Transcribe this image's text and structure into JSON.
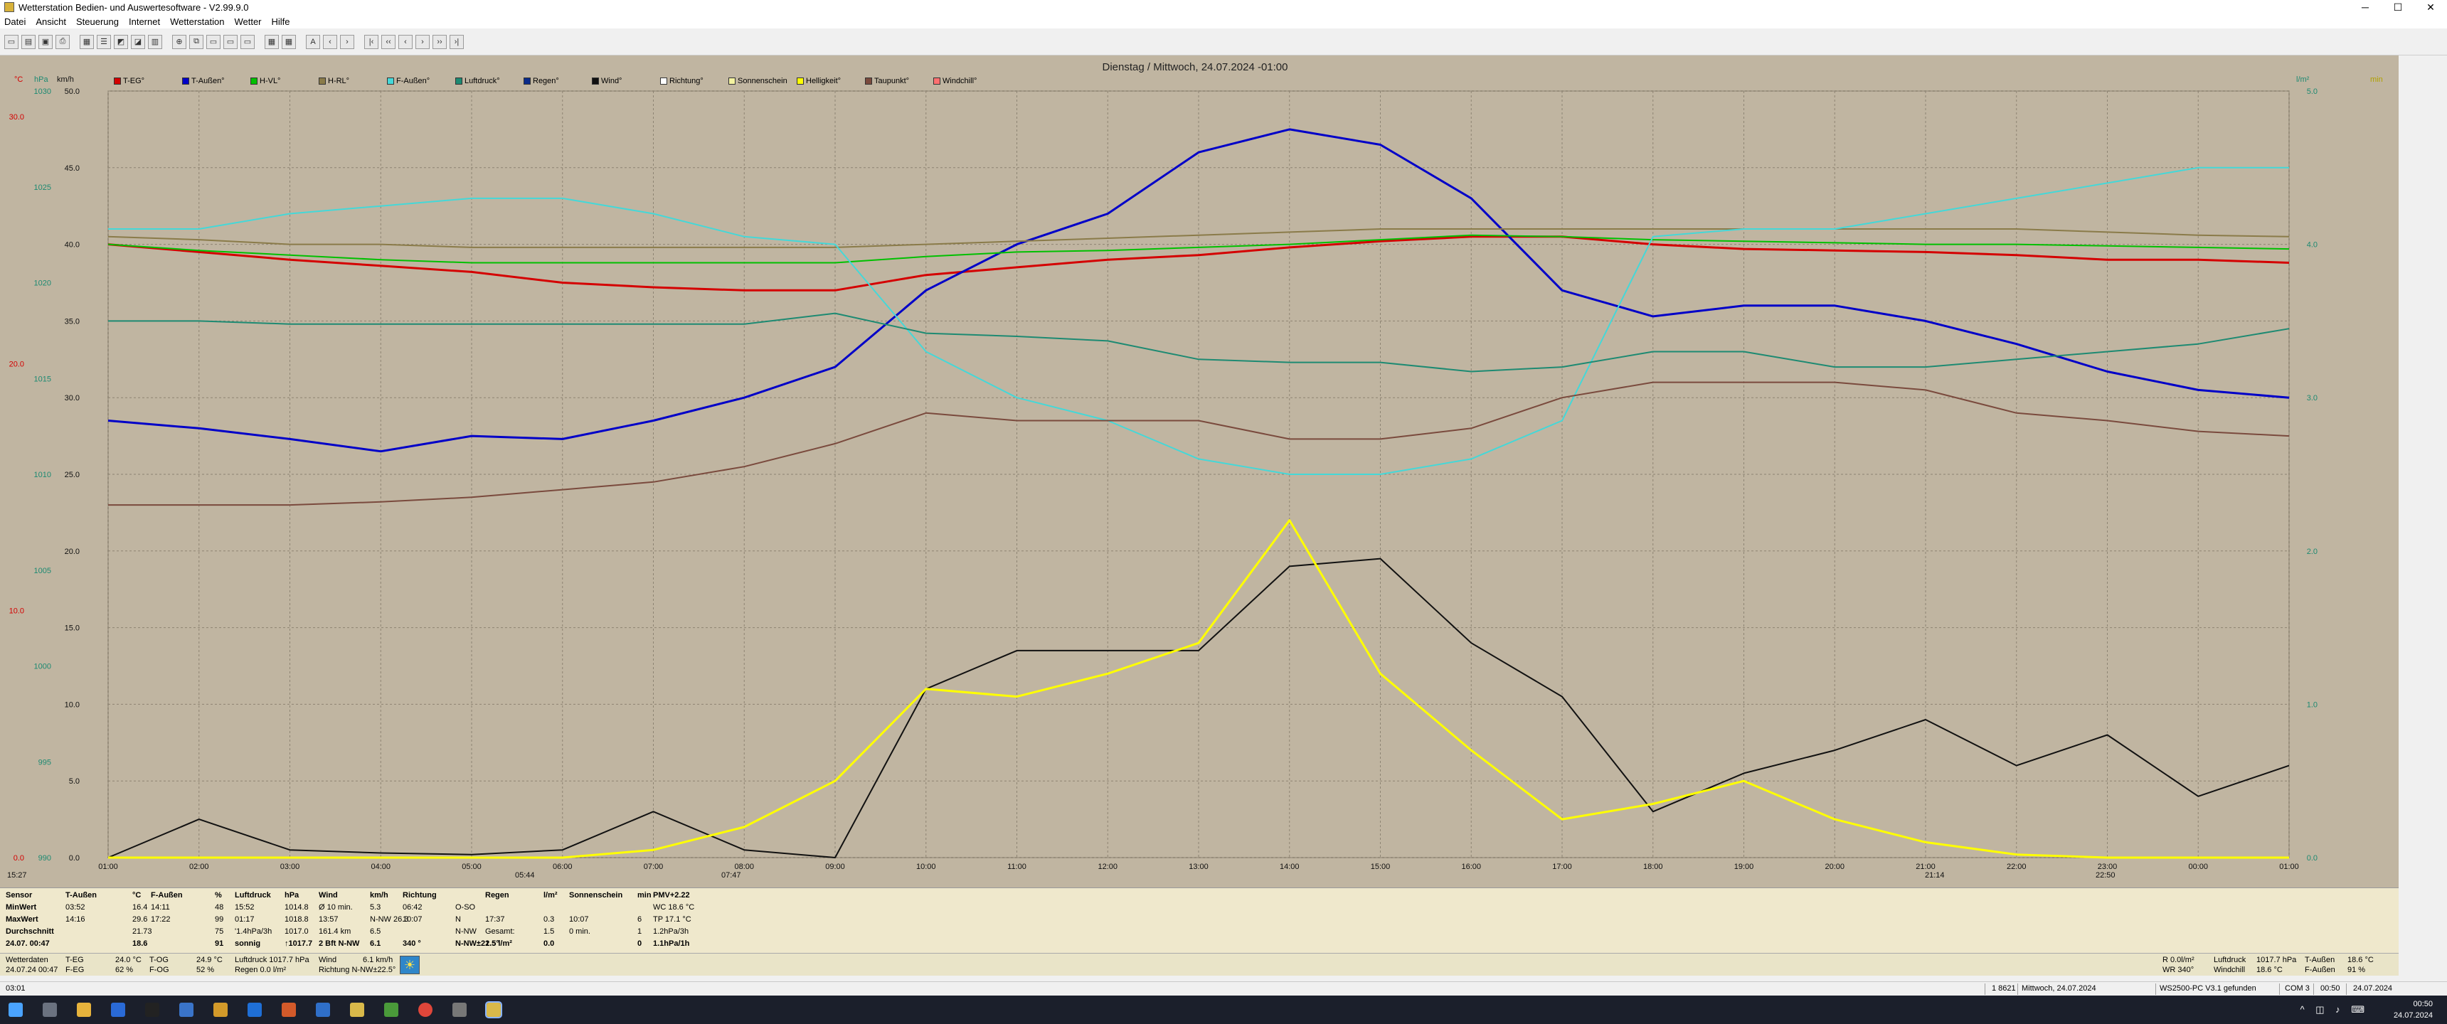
{
  "window": {
    "title": "Wetterstation Bedien- und Auswertesoftware - V2.99.9.0",
    "controls": [
      "─",
      "☐",
      "✕"
    ]
  },
  "menu": [
    "Datei",
    "Ansicht",
    "Steuerung",
    "Internet",
    "Wetterstation",
    "Wetter",
    "Hilfe"
  ],
  "toolbar": {
    "nav_buttons": [
      "A",
      "‹",
      "›",
      "|‹",
      "‹‹",
      "‹",
      "›",
      "››",
      "›|"
    ]
  },
  "chart_title": "Dienstag / Mittwoch, 24.07.2024 -01:00",
  "legend": [
    {
      "label": "T-EG°",
      "color": "#d40000"
    },
    {
      "label": "T-Außen°",
      "color": "#0000c8"
    },
    {
      "label": "H-VL°",
      "color": "#00c000"
    },
    {
      "label": "H-RL°",
      "color": "#8a7b49"
    },
    {
      "label": "F-Außen°",
      "color": "#44d8d8"
    },
    {
      "label": "Luftdruck°",
      "color": "#1d8a72"
    },
    {
      "label": "Regen°",
      "color": "#0a2b8a"
    },
    {
      "label": "Wind°",
      "color": "#111111"
    },
    {
      "label": "Richtung°",
      "color": "#ffffff"
    },
    {
      "label": "Sonnenschein",
      "color": "#f3f2a0"
    },
    {
      "label": "Helligkeit°",
      "color": "#ffff00"
    },
    {
      "label": "Taupunkt°",
      "color": "#7a4a3d"
    },
    {
      "label": "Windchill°",
      "color": "#ff7070"
    }
  ],
  "left_axes": {
    "unit_c": "°C",
    "unit_hpa": "hPa",
    "unit_kmh": "km/h",
    "c_ticks": [
      "30.0",
      "20.0",
      "10.0",
      "0.0"
    ],
    "hpa_ticks": [
      "1030",
      "1025",
      "1020",
      "1015",
      "1010",
      "1005",
      "1000",
      "995",
      "990"
    ],
    "kmh_ticks": [
      "50.0",
      "45.0",
      "40.0",
      "35.0",
      "30.0",
      "25.0",
      "20.0",
      "15.0",
      "10.0",
      "5.0",
      "0.0"
    ]
  },
  "right_axes": {
    "unit_lm2": "l/m²",
    "unit_min": "min",
    "lm2_ticks": [
      "5.0",
      "4.0",
      "3.0",
      "2.0",
      "1.0",
      "0.0"
    ]
  },
  "time_ticks": [
    "01:00",
    "02:00",
    "03:00",
    "04:00",
    "05:00",
    "06:00",
    "07:00",
    "08:00",
    "09:00",
    "10:00",
    "11:00",
    "12:00",
    "13:00",
    "14:00",
    "15:00",
    "16:00",
    "17:00",
    "18:00",
    "19:00",
    "20:00",
    "21:00",
    "22:00",
    "23:00",
    "00:00",
    "01:00"
  ],
  "time_markers": [
    "15:27",
    "05:44",
    "07:47",
    "21:14",
    "22:50"
  ],
  "chart_data": {
    "type": "line",
    "title": "Dienstag / Mittwoch, 24.07.2024 -01:00",
    "x": [
      "01:00",
      "02:00",
      "03:00",
      "04:00",
      "05:00",
      "06:00",
      "07:00",
      "08:00",
      "09:00",
      "10:00",
      "11:00",
      "12:00",
      "13:00",
      "14:00",
      "15:00",
      "16:00",
      "17:00",
      "18:00",
      "19:00",
      "20:00",
      "21:00",
      "22:00",
      "23:00",
      "00:00",
      "01:00"
    ],
    "ylim": [
      0,
      50
    ],
    "grid": true,
    "series": [
      {
        "name": "T-EG°",
        "color": "#d40000",
        "values": [
          40,
          39.5,
          39,
          38.6,
          38.2,
          37.5,
          37.2,
          37,
          37,
          38,
          38.5,
          39,
          39.3,
          39.8,
          40.2,
          40.5,
          40.5,
          40,
          39.7,
          39.6,
          39.5,
          39.3,
          39,
          39,
          38.8
        ]
      },
      {
        "name": "T-Außen°",
        "color": "#0000c8",
        "values": [
          28.5,
          28,
          27.3,
          26.5,
          27.5,
          27.3,
          28.5,
          30,
          32,
          37,
          40,
          42,
          46,
          47.5,
          46.5,
          43,
          37,
          35.3,
          36,
          36,
          35,
          33.5,
          31.7,
          30.5,
          30
        ]
      },
      {
        "name": "H-VL°",
        "color": "#00c000",
        "values": [
          40,
          39.6,
          39.3,
          39,
          38.8,
          38.8,
          38.8,
          38.8,
          38.8,
          39.2,
          39.5,
          39.6,
          39.8,
          40,
          40.3,
          40.6,
          40.5,
          40.3,
          40.2,
          40.1,
          40,
          40,
          39.9,
          39.8,
          39.7
        ]
      },
      {
        "name": "H-RL°",
        "color": "#8a7b49",
        "values": [
          40.5,
          40.3,
          40,
          40,
          39.8,
          39.8,
          39.8,
          39.8,
          39.8,
          40,
          40.2,
          40.4,
          40.6,
          40.8,
          41,
          41,
          41,
          41,
          41,
          41,
          41,
          41,
          40.8,
          40.6,
          40.5
        ]
      },
      {
        "name": "F-Außen°",
        "color": "#44d8d8",
        "values": [
          41,
          41,
          42,
          42.5,
          43,
          43,
          42,
          40.5,
          40,
          33,
          30,
          28.5,
          26,
          25,
          25,
          26,
          28.5,
          40.5,
          41,
          41,
          42,
          43,
          44,
          45,
          45
        ]
      },
      {
        "name": "Luftdruck°",
        "color": "#1d8a72",
        "values": [
          35,
          35,
          34.8,
          34.8,
          34.8,
          34.8,
          34.8,
          34.8,
          35.5,
          34.2,
          34,
          33.7,
          32.5,
          32.3,
          32.3,
          31.7,
          32,
          33,
          33,
          32,
          32,
          32.5,
          33,
          33.5,
          34.5
        ]
      },
      {
        "name": "Taupunkt°",
        "color": "#7a4a3d",
        "values": [
          23,
          23,
          23,
          23.2,
          23.5,
          24,
          24.5,
          25.5,
          27,
          29,
          28.5,
          28.5,
          28.5,
          27.3,
          27.3,
          28,
          30,
          31,
          31,
          31,
          30.5,
          29,
          28.5,
          27.8,
          27.5
        ]
      },
      {
        "name": "Wind°",
        "color": "#111111",
        "values": [
          0,
          2.5,
          0.5,
          0.3,
          0.2,
          0.5,
          3,
          0.5,
          0,
          11,
          13.5,
          13.5,
          13.5,
          19,
          19.5,
          14,
          10.5,
          3,
          5.5,
          7,
          9,
          6,
          8,
          4,
          6
        ]
      },
      {
        "name": "Helligkeit°",
        "color": "#ffff00",
        "values": [
          0,
          0,
          0,
          0,
          0,
          0,
          0.5,
          2,
          5,
          11,
          10.5,
          12,
          14,
          22,
          12,
          7,
          2.5,
          3.5,
          5,
          2.5,
          1,
          0.2,
          0,
          0,
          0
        ]
      }
    ]
  },
  "info_panel": {
    "headers": [
      "Sensor",
      "T-Außen",
      "°C",
      "F-Außen",
      "%",
      "Luftdruck",
      "hPa",
      "Wind",
      "km/h",
      "Richtung",
      "",
      "Regen",
      "l/m²",
      "Sonnenschein",
      "min",
      "PMV+2.22"
    ],
    "rows": [
      [
        "MinWert",
        "03:52",
        "16.4",
        "14:11",
        "48",
        "15:52",
        "1014.8",
        "Ø 10 min.",
        "5.3",
        "06:42",
        "O-SO",
        "",
        "",
        "",
        "",
        "WC 18.6 °C"
      ],
      [
        "MaxWert",
        "14:16",
        "29.6",
        "17:22",
        "99",
        "01:17",
        "1018.8",
        "13:57",
        "N-NW 26.3",
        "10:07",
        "N",
        "17:37",
        "0.3",
        "10:07",
        "6",
        "TP 17.1 °C"
      ],
      [
        "Durchschnitt",
        "",
        "21.73",
        "",
        "75",
        "'1.4hPa/3h",
        "1017.0",
        "161.4 km",
        "6.5",
        "",
        "N-NW",
        "Gesamt:",
        "1.5",
        "0 min.",
        "1",
        "1.2hPa/3h"
      ],
      [
        "24.07. 00:47",
        "",
        "18.6",
        "",
        "91",
        "sonnig",
        "↑1017.7",
        "2 Bft N-NW",
        "6.1",
        "340 °",
        "N-NW±22.5°",
        "1.5 l/m²",
        "0.0",
        "",
        "0",
        "1.1hPa/1h"
      ]
    ]
  },
  "bottom_info": {
    "col1": [
      "Wetterdaten",
      "24.07.24 00:47"
    ],
    "col2": [
      "T-EG",
      "F-EG"
    ],
    "col3": [
      "24.0 °C",
      "62 %"
    ],
    "col4": [
      "T-OG",
      "F-OG"
    ],
    "col5": [
      "24.9 °C",
      "52 %"
    ],
    "col6": [
      "Luftdruck  1017.7 hPa",
      "Regen         0.0 l/m²"
    ],
    "col7": [
      "Wind",
      "Richtung  N-NW±22.5°"
    ],
    "col8": [
      "6.1 km/h",
      ""
    ],
    "right1": [
      "R 0.0l/m²",
      "WR 340°"
    ],
    "right2": [
      "Luftdruck",
      "Windchill"
    ],
    "right3": [
      "1017.7 hPa",
      "18.6 °C"
    ],
    "right4": [
      "T-Außen",
      "F-Außen"
    ],
    "right5": [
      "18.6 °C",
      "91 %"
    ]
  },
  "status_bar": {
    "left": "03:01",
    "s1": "1 8621",
    "s2": "Mittwoch, 24.07.2024",
    "s3": "WS2500-PC V3.1 gefunden",
    "s4": "COM 3",
    "s5": "00:50",
    "s6": "24.07.2024"
  },
  "taskbar": {
    "time": "00:50",
    "date": "24.07.2024",
    "tray_icons": "^ ◫ ♪ ⌨"
  }
}
